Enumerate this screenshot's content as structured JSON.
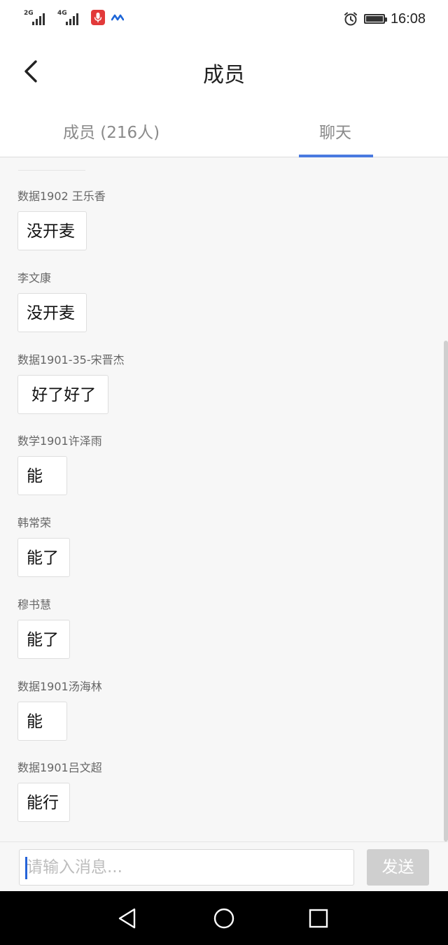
{
  "status_bar": {
    "signal_1_label": "2G",
    "signal_2_label": "4G",
    "time": "16:08",
    "battery_level": 1.0,
    "icons": [
      "signal-icon",
      "microphone-icon",
      "meeting-app-icon",
      "alarm-icon",
      "battery-icon"
    ]
  },
  "header": {
    "title": "成员",
    "back_icon": "chevron-left-icon"
  },
  "tabs": [
    {
      "label": "成员 (216人)",
      "active": false
    },
    {
      "label": "聊天",
      "active": true
    }
  ],
  "messages": [
    {
      "sender": "数据1902  王乐香",
      "text": "没开麦"
    },
    {
      "sender": "李文康",
      "text": "没开麦"
    },
    {
      "sender": "数据1901-35-宋晋杰",
      "text": " 好了好了"
    },
    {
      "sender": "数学1901许泽雨",
      "text": "能"
    },
    {
      "sender": "韩常荣",
      "text": "能了"
    },
    {
      "sender": "穆书慧",
      "text": "能了"
    },
    {
      "sender": "数据1901汤海林",
      "text": "能"
    },
    {
      "sender": "数据1901吕文超",
      "text": "能行"
    }
  ],
  "input": {
    "placeholder": "请输入消息...",
    "value": ""
  },
  "send_label": "发送",
  "colors": {
    "accent": "#4a7ae0",
    "caret": "#2563d8",
    "send_disabled": "#cfcfcf",
    "mic_badge": "#e23a3a",
    "meeting_icon": "#1e66d8"
  },
  "nav_bar": {
    "icons": [
      "nav-back-icon",
      "nav-home-icon",
      "nav-recents-icon"
    ]
  }
}
